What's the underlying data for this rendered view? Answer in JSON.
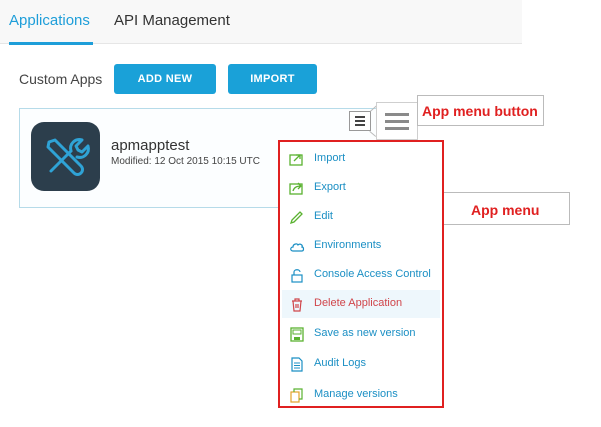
{
  "tabs": [
    {
      "label": "Applications",
      "active": true
    },
    {
      "label": "API Management",
      "active": false
    }
  ],
  "toolbar": {
    "section_label": "Custom Apps",
    "add_new_label": "ADD NEW",
    "import_label": "IMPORT"
  },
  "app_card": {
    "name": "apmapptest",
    "modified": "Modified: 12 Oct 2015 10:15 UTC",
    "icon": "tools-icon"
  },
  "callouts": {
    "menu_button": "App menu button",
    "menu": "App menu"
  },
  "menu": {
    "items": [
      {
        "label": "Import",
        "icon": "import-icon"
      },
      {
        "label": "Export",
        "icon": "export-icon"
      },
      {
        "label": "Edit",
        "icon": "pencil-icon"
      },
      {
        "label": "Environments",
        "icon": "cloud-icon"
      },
      {
        "label": "Console Access Control",
        "icon": "lock-icon"
      },
      {
        "label": "Delete Application",
        "icon": "trash-icon"
      },
      {
        "label": "Save as new version",
        "icon": "save-icon"
      },
      {
        "label": "Audit Logs",
        "icon": "document-icon"
      },
      {
        "label": "Manage versions",
        "icon": "versions-icon"
      }
    ]
  },
  "colors": {
    "accent": "#1e9ed9",
    "button": "#1aa1d8",
    "callout": "#e02020",
    "icon_green": "#5ab230",
    "danger": "#d0454a"
  }
}
